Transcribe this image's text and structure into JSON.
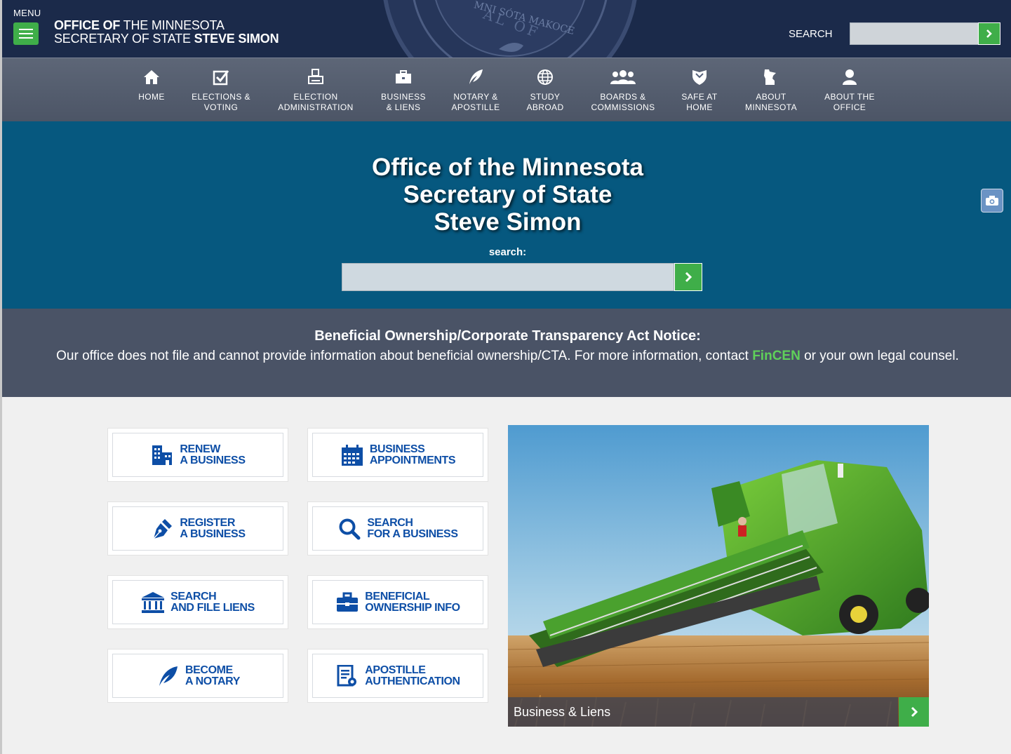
{
  "header": {
    "menu_label": "MENU",
    "title_line1_bold": "OFFICE OF",
    "title_line1_rest": " THE MINNESOTA",
    "title_line2_rest": "SECRETARY OF STATE ",
    "title_line2_bold": "STEVE SIMON",
    "search_label": "SEARCH",
    "search_placeholder": "",
    "seal_text": "MNI SÓTA MAKOCE"
  },
  "nav": {
    "items": [
      {
        "label": "HOME",
        "icon": "home-icon"
      },
      {
        "label": "ELECTIONS &\nVOTING",
        "icon": "checkbox-icon"
      },
      {
        "label": "ELECTION\nADMINISTRATION",
        "icon": "printer-icon"
      },
      {
        "label": "BUSINESS\n& LIENS",
        "icon": "briefcase-icon"
      },
      {
        "label": "NOTARY &\nAPOSTILLE",
        "icon": "quill-icon"
      },
      {
        "label": "STUDY\nABROAD",
        "icon": "globe-icon"
      },
      {
        "label": "BOARDS &\nCOMMISSIONS",
        "icon": "group-icon"
      },
      {
        "label": "SAFE AT\nHOME",
        "icon": "shield-icon"
      },
      {
        "label": "ABOUT\nMINNESOTA",
        "icon": "minnesota-icon"
      },
      {
        "label": "ABOUT THE\nOFFICE",
        "icon": "person-icon"
      }
    ]
  },
  "hero": {
    "title_line1": "Office of the Minnesota",
    "title_line2": "Secretary of State",
    "title_line3": "Steve Simon",
    "search_label": "search:",
    "search_placeholder": ""
  },
  "notice": {
    "title": "Beneficial Ownership/Corporate Transparency Act Notice:",
    "body_before": "Our office does not file and cannot provide information about beneficial ownership/CTA. For more information, contact ",
    "link": "FinCEN",
    "body_after": " or your own legal counsel."
  },
  "tiles": [
    {
      "line1": "RENEW",
      "line2": "A BUSINESS",
      "icon": "building-icon"
    },
    {
      "line1": "BUSINESS",
      "line2": "APPOINTMENTS",
      "icon": "calendar-icon"
    },
    {
      "line1": "REGISTER",
      "line2": "A BUSINESS",
      "icon": "pen-icon"
    },
    {
      "line1": "SEARCH",
      "line2": "FOR A BUSINESS",
      "icon": "search-icon"
    },
    {
      "line1": "SEARCH",
      "line2": "AND FILE LIENS",
      "icon": "bank-icon"
    },
    {
      "line1": "BENEFICIAL",
      "line2": "OWNERSHIP INFO",
      "icon": "briefcase-icon"
    },
    {
      "line1": "BECOME",
      "line2": "A NOTARY",
      "icon": "feather-icon"
    },
    {
      "line1": "APOSTILLE",
      "line2": "AUTHENTICATION",
      "icon": "certificate-icon"
    }
  ],
  "feature": {
    "caption": "Business & Liens",
    "image": "combine-harvester-in-wheat-field"
  },
  "colors": {
    "header_bg": "#1b2a4a",
    "hero_bg": "#06587f",
    "notice_bg": "#4a5366",
    "accent_green": "#3fae49",
    "tile_text": "#0d4ea6"
  }
}
